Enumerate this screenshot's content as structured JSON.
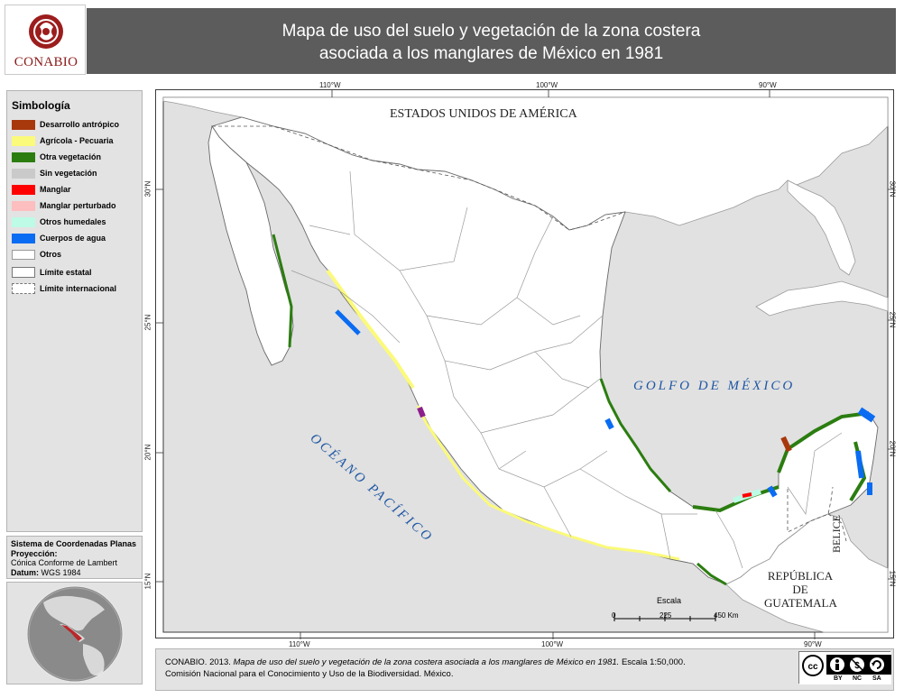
{
  "header": {
    "logo_text": "CONABIO",
    "title_line1": "Mapa de uso del suelo y vegetación de la zona costera",
    "title_line2": "asociada a los manglares de México en 1981"
  },
  "legend": {
    "title": "Simbología",
    "items": [
      {
        "label": "Desarrollo antrópico",
        "color": "#a8390d"
      },
      {
        "label": "Agrícola - Pecuaria",
        "color": "#fbfa7a"
      },
      {
        "label": "Otra vegetación",
        "color": "#2b7d10"
      },
      {
        "label": "Sin vegetación",
        "color": "#cacaca"
      },
      {
        "label": "Manglar",
        "color": "#ff0000"
      },
      {
        "label": "Manglar perturbado",
        "color": "#fcbebe"
      },
      {
        "label": "Otros humedales",
        "color": "#bdfbe6"
      },
      {
        "label": "Cuerpos de agua",
        "color": "#0a6cf2"
      },
      {
        "label": "Otros",
        "color": "#ffffff"
      }
    ],
    "boundaries": [
      {
        "label": "Límite estatal",
        "style": "solid"
      },
      {
        "label": "Límite internacional",
        "style": "dashed"
      }
    ]
  },
  "crs": {
    "system_label": "Sistema de Coordenadas Planas",
    "projection_label": "Proyección:",
    "projection_value": "Cónica Conforme de Lambert",
    "datum_label": "Datum:",
    "datum_value": "WGS 1984"
  },
  "map": {
    "graticule": {
      "top": [
        "110°W",
        "100°W",
        "90°W"
      ],
      "bottom": [
        "110°W",
        "100°W",
        "90°W"
      ],
      "left": [
        "30°N",
        "25°N",
        "20°N",
        "15°N"
      ],
      "right": [
        "30°N",
        "25°N",
        "20°N",
        "15°N"
      ]
    },
    "places": {
      "usa": "ESTADOS UNIDOS DE AMÉRICA",
      "gulf": "GOLFO DE MÉXICO",
      "pacific": "OCÉANO PACÍFICO",
      "belice": "BELICE",
      "guatemala_line1": "REPÚBLICA",
      "guatemala_line2": "DE",
      "guatemala_line3": "GUATEMALA"
    },
    "scale": {
      "title": "Escala",
      "ticks": [
        "0",
        "225",
        "450 Km"
      ]
    },
    "colors": {
      "ocean": "#e1e1e1",
      "land": "#ffffff",
      "border": "#9a9a9a",
      "frame": "#3b3b3b"
    }
  },
  "footer": {
    "line1_prefix": "CONABIO. 2013.",
    "line1_title": "Mapa de uso del suelo y vegetación de la zona costera asociada a los manglares de México en 1981.",
    "line1_scale": "Escala 1:50,000.",
    "line2": "Comisión Nacional para el Conocimiento y Uso de la Biodiversidad. México."
  },
  "license": {
    "icons": [
      "cc-icon",
      "by-icon",
      "nc-icon",
      "sa-icon"
    ],
    "labels": [
      "BY",
      "NC",
      "SA"
    ]
  }
}
